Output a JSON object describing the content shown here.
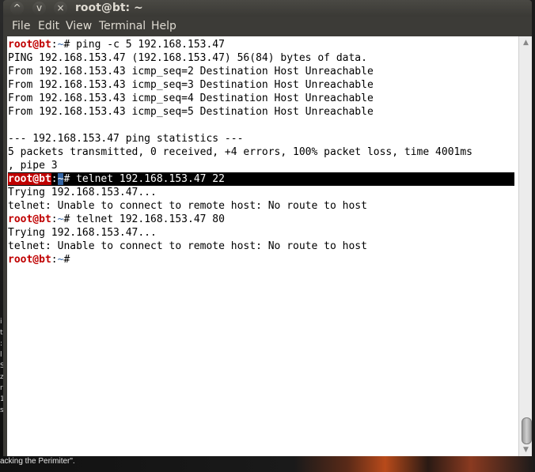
{
  "window": {
    "title": "root@bt: ~",
    "buttons": {
      "up": "^",
      "down": "v",
      "close": "×"
    }
  },
  "menu": [
    "File",
    "Edit",
    "View",
    "Terminal",
    "Help"
  ],
  "terminal": {
    "prompt_user": "root@bt",
    "prompt_sep": ":",
    "prompt_dir": "~",
    "lines": [
      {
        "type": "cmd",
        "text": "# ping -c 5 192.168.153.47"
      },
      {
        "type": "out",
        "text": "PING 192.168.153.47 (192.168.153.47) 56(84) bytes of data."
      },
      {
        "type": "out",
        "text": "From 192.168.153.43 icmp_seq=2 Destination Host Unreachable"
      },
      {
        "type": "out",
        "text": "From 192.168.153.43 icmp_seq=3 Destination Host Unreachable"
      },
      {
        "type": "out",
        "text": "From 192.168.153.43 icmp_seq=4 Destination Host Unreachable"
      },
      {
        "type": "out",
        "text": "From 192.168.153.43 icmp_seq=5 Destination Host Unreachable"
      },
      {
        "type": "out",
        "text": ""
      },
      {
        "type": "out",
        "text": "--- 192.168.153.47 ping statistics ---"
      },
      {
        "type": "out",
        "text": "5 packets transmitted, 0 received, +4 errors, 100% packet loss, time 4001ms"
      },
      {
        "type": "out",
        "text": ", pipe 3"
      },
      {
        "type": "cmd_hl",
        "text": "# telnet 192.168.153.47 22"
      },
      {
        "type": "out",
        "text": "Trying 192.168.153.47..."
      },
      {
        "type": "out",
        "text": "telnet: Unable to connect to remote host: No route to host"
      },
      {
        "type": "cmd",
        "text": "# telnet 192.168.153.47 80"
      },
      {
        "type": "out",
        "text": "Trying 192.168.153.47..."
      },
      {
        "type": "out",
        "text": "telnet: Unable to connect to remote host: No route to host"
      },
      {
        "type": "cmd",
        "text": "#"
      }
    ]
  },
  "desktop": {
    "bottom_text": "acking the Perimiter\"."
  }
}
